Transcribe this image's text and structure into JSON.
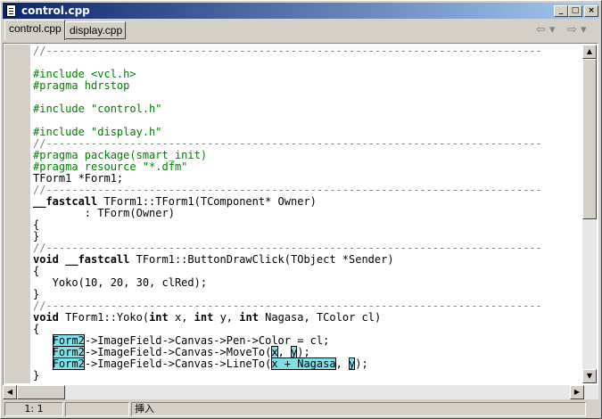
{
  "window": {
    "title": "control.cpp"
  },
  "title_buttons": {
    "minimize": "_",
    "maximize": "□",
    "close": "×"
  },
  "tabs": [
    {
      "label": "control.cpp",
      "active": true
    },
    {
      "label": "display.cpp",
      "active": false
    }
  ],
  "nav": {
    "back": "⇦ ▾",
    "forward": "⇨ ▾"
  },
  "code_lines": [
    [
      [
        "//-----------------------------------------------------------------------------",
        "cm"
      ]
    ],
    [],
    [
      [
        "#include <vcl.h>",
        "pp"
      ]
    ],
    [
      [
        "#pragma hdrstop",
        "pp"
      ]
    ],
    [],
    [
      [
        "#include \"control.h\"",
        "pp"
      ]
    ],
    [],
    [
      [
        "#include \"display.h\"",
        "pp"
      ]
    ],
    [
      [
        "//-----------------------------------------------------------------------------",
        "cm"
      ]
    ],
    [
      [
        "#pragma package(smart_init)",
        "pp"
      ]
    ],
    [
      [
        "#pragma resource \"*.dfm\"",
        "pp"
      ]
    ],
    [
      [
        "TForm1 *Form1;",
        ""
      ]
    ],
    [
      [
        "//-----------------------------------------------------------------------------",
        "cm"
      ]
    ],
    [
      [
        "__fastcall",
        "kw"
      ],
      [
        " TForm1::TForm1(TComponent* Owner)",
        ""
      ]
    ],
    [
      [
        "        : TForm(Owner)",
        ""
      ]
    ],
    [
      [
        "{",
        ""
      ]
    ],
    [
      [
        "}",
        ""
      ]
    ],
    [
      [
        "//-----------------------------------------------------------------------------",
        "cm"
      ]
    ],
    [
      [
        "void __fastcall",
        "kw"
      ],
      [
        " TForm1::ButtonDrawClick(TObject *Sender)",
        ""
      ]
    ],
    [
      [
        "{",
        ""
      ]
    ],
    [
      [
        "   Yoko(10, 20, 30, clRed);",
        ""
      ]
    ],
    [
      [
        "}",
        ""
      ]
    ],
    [
      [
        "//-----------------------------------------------------------------------------",
        "cm"
      ]
    ],
    [
      [
        "void",
        "kw"
      ],
      [
        " TForm1::Yoko(",
        ""
      ],
      [
        "int",
        "kw"
      ],
      [
        " x, ",
        ""
      ],
      [
        "int",
        "kw"
      ],
      [
        " y, ",
        ""
      ],
      [
        "int",
        "kw"
      ],
      [
        " Nagasa, TColor cl)",
        ""
      ]
    ],
    [
      [
        "{",
        ""
      ]
    ],
    [
      [
        "   ",
        ""
      ],
      [
        "Form2",
        "hl"
      ],
      [
        "->ImageField->Canvas->Pen->Color = cl;",
        ""
      ]
    ],
    [
      [
        "   ",
        ""
      ],
      [
        "Form2",
        "hl"
      ],
      [
        "->ImageField->Canvas->MoveTo(",
        ""
      ],
      [
        "x",
        "hl"
      ],
      [
        ", ",
        ""
      ],
      [
        "y",
        "hl"
      ],
      [
        ");",
        ""
      ]
    ],
    [
      [
        "   ",
        ""
      ],
      [
        "Form2",
        "hl"
      ],
      [
        "->ImageField->Canvas->LineTo(",
        ""
      ],
      [
        "x + Nagasa",
        "hl"
      ],
      [
        ", ",
        ""
      ],
      [
        "y",
        "hl"
      ],
      [
        ");",
        ""
      ]
    ],
    [
      [
        "}",
        ""
      ]
    ]
  ],
  "scrollbar": {
    "up": "▲",
    "down": "▼",
    "left": "◀",
    "right": "▶"
  },
  "status": {
    "position": "1:  1",
    "mode": "挿入"
  }
}
